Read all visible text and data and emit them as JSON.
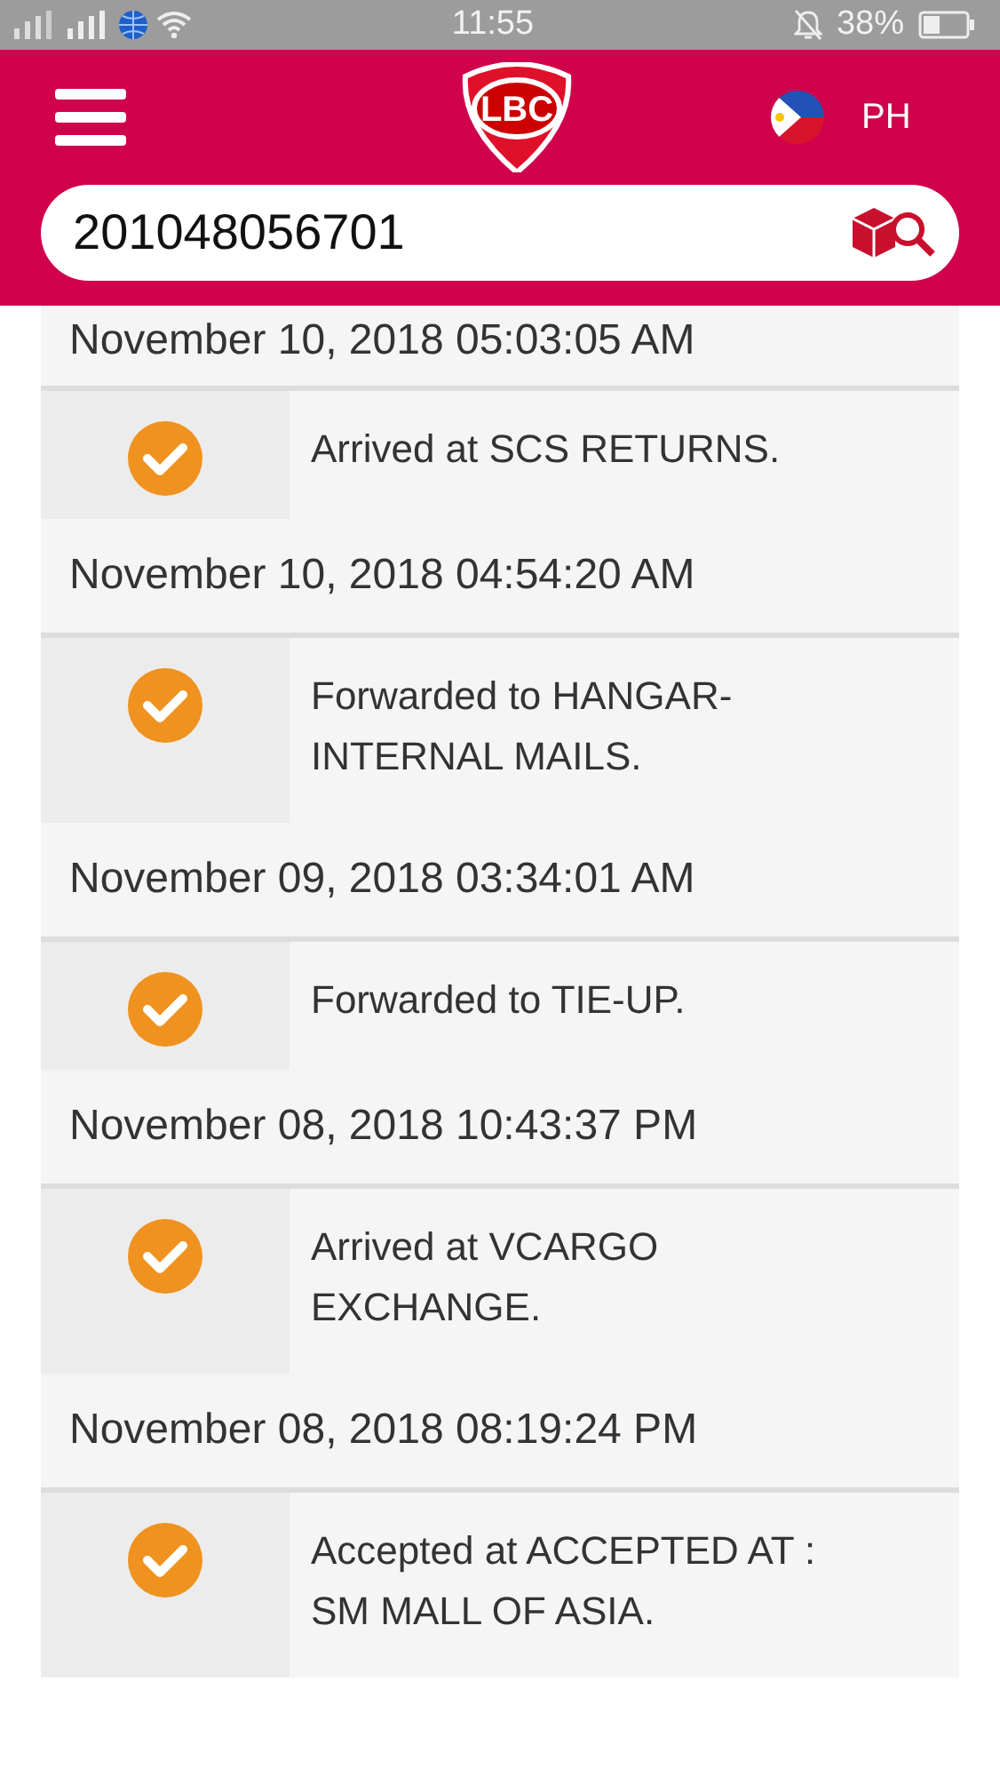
{
  "status_bar": {
    "time": "11:55",
    "battery": "38%"
  },
  "header": {
    "logo": "LBC",
    "country": "PH"
  },
  "search": {
    "value": "201048056701"
  },
  "events": [
    {
      "datetime": "November 10, 2018 05:03:05 AM",
      "description": "Arrived at SCS RETURNS.",
      "done": true
    },
    {
      "datetime": "November 10, 2018 04:54:20 AM",
      "description": "Forwarded to HANGAR-INTERNAL MAILS.",
      "done": true
    },
    {
      "datetime": "November 09, 2018 03:34:01 AM",
      "description": "Forwarded to TIE-UP.",
      "done": true
    },
    {
      "datetime": "November 08, 2018 10:43:37 PM",
      "description": "Arrived at VCARGO EXCHANGE.",
      "done": true
    },
    {
      "datetime": "November 08, 2018 08:19:24 PM",
      "description": "Accepted at ACCEPTED AT : SM MALL OF ASIA.",
      "done": true
    }
  ]
}
